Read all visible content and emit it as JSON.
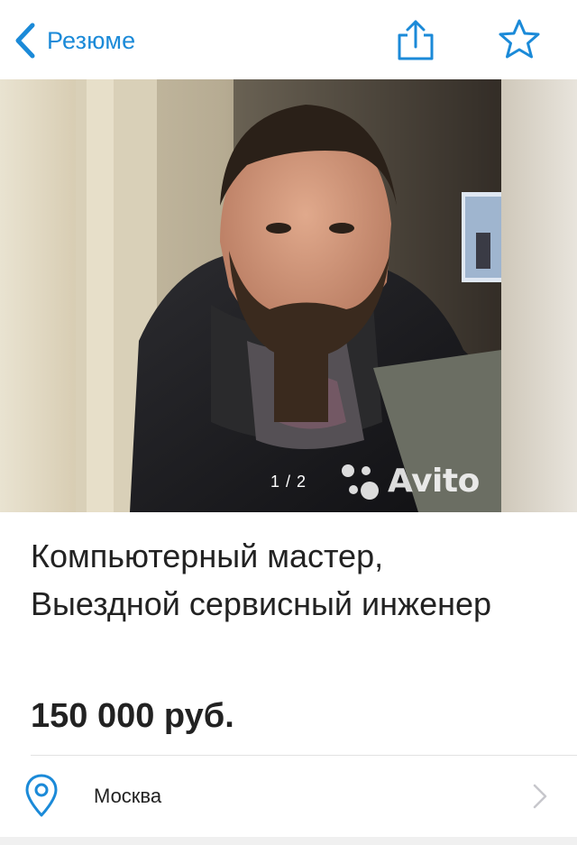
{
  "navbar": {
    "back_label": "Резюме",
    "back_icon": "chevron-left-icon",
    "share_icon": "share-icon",
    "favorite_icon": "star-icon",
    "accent_color": "#1b8ad8"
  },
  "gallery": {
    "counter": "1 / 2",
    "current_photo": 1,
    "total_photos": 2,
    "watermark": "Avito"
  },
  "listing": {
    "title": "Компьютерный мастер, Выездной сервисный инженер",
    "price": "150 000 руб."
  },
  "location": {
    "label": "Москва",
    "icon": "location-pin-icon",
    "chevron": "chevron-right-icon"
  }
}
